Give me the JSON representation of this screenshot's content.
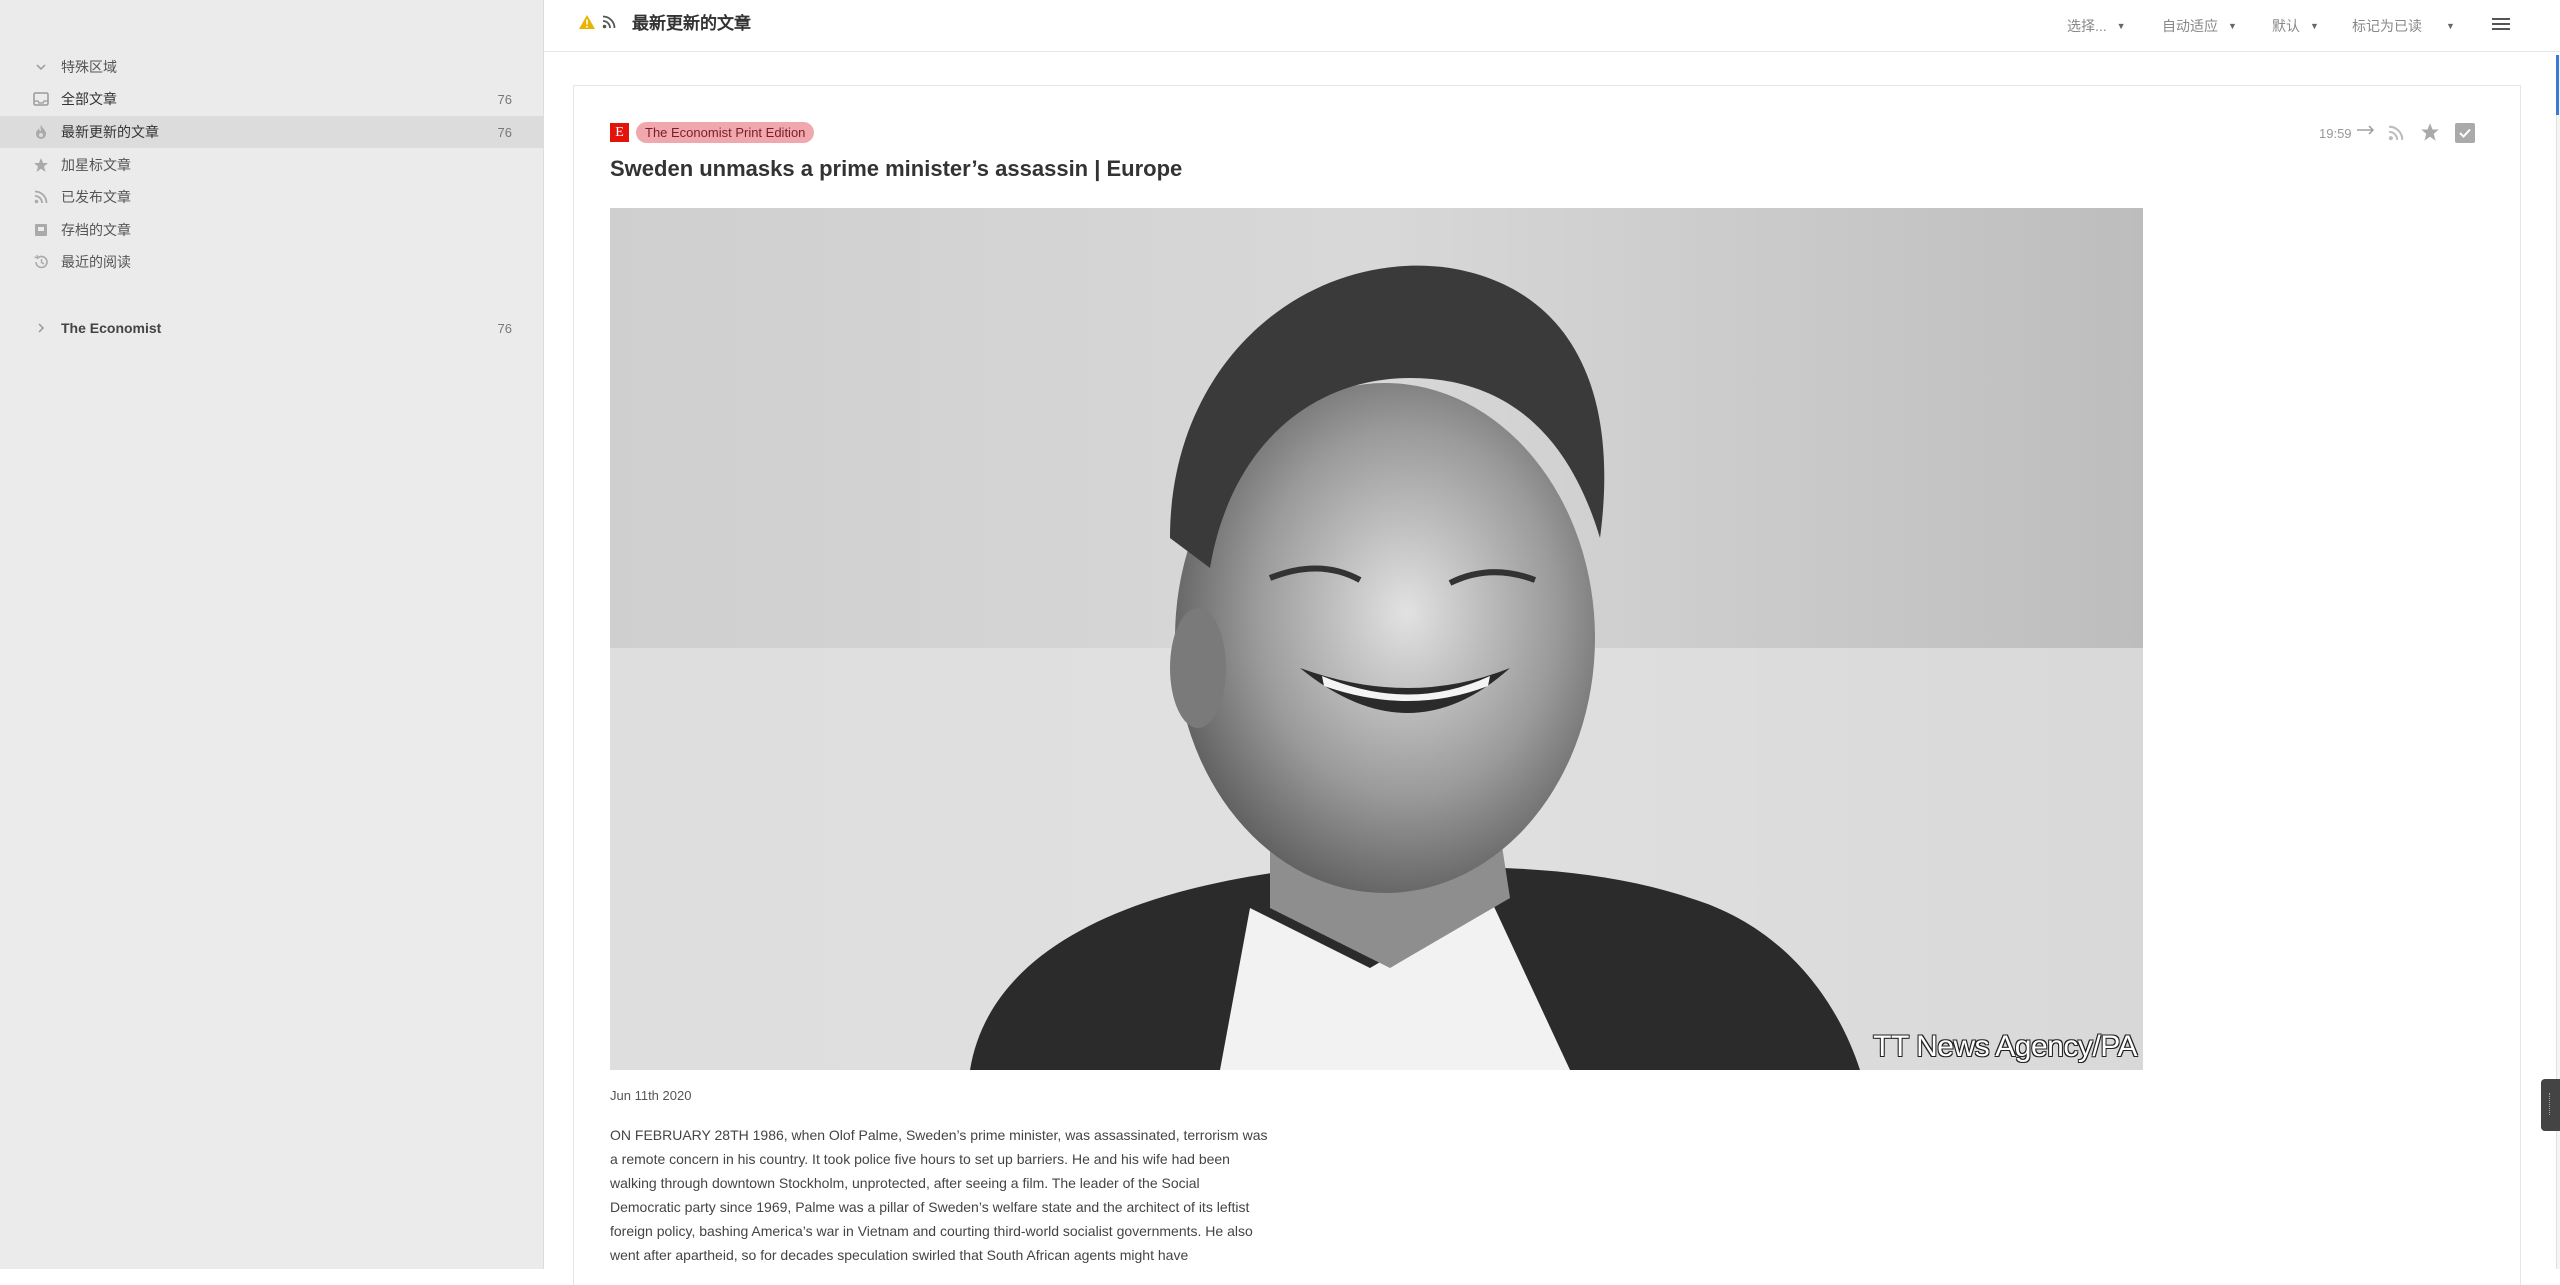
{
  "sidebar": {
    "special_section": "特殊区域",
    "items": [
      {
        "label": "全部文章",
        "count": "76",
        "icon": "inbox-icon"
      },
      {
        "label": "最新更新的文章",
        "count": "76",
        "icon": "fire-icon"
      },
      {
        "label": "加星标文章",
        "count": "",
        "icon": "star-icon"
      },
      {
        "label": "已发布文章",
        "count": "",
        "icon": "rss-icon"
      },
      {
        "label": "存档的文章",
        "count": "",
        "icon": "archive-icon"
      },
      {
        "label": "最近的阅读",
        "count": "",
        "icon": "history-icon"
      }
    ],
    "feeds": [
      {
        "label": "The Economist",
        "count": "76"
      }
    ]
  },
  "header": {
    "title": "最新更新的文章",
    "select_label": "选择...",
    "adaptive_label": "自动适应",
    "sort_label": "默认",
    "mark_read_label": "标记为已读"
  },
  "article": {
    "source_tag": "The Economist Print Edition",
    "logo_letter": "E",
    "time": "19:59",
    "title": "Sweden unmasks a prime minister’s assassin | Europe",
    "photo_credit": "TT News Agency/PA",
    "date": "Jun 11th 2020",
    "body": "ON FEBRUARY 28TH 1986, when Olof Palme, Sweden’s prime minister, was assassinated, terrorism was a remote concern in his country. It took police five hours to set up barriers. He and his wife had been walking through downtown Stockholm, unprotected, after seeing a film. The leader of the Social Democratic party since 1969, Palme was a pillar of Sweden’s welfare state and the architect of its leftist foreign policy, bashing America’s war in Vietnam and courting third-world socialist governments. He also went after apartheid, so for decades speculation swirled that South African agents might have"
  },
  "colors": {
    "accent_blue": "#3a7bd5",
    "economist_red": "#e3120b",
    "tag_pink": "#f0a8ae",
    "warning_yellow": "#e8b400"
  }
}
